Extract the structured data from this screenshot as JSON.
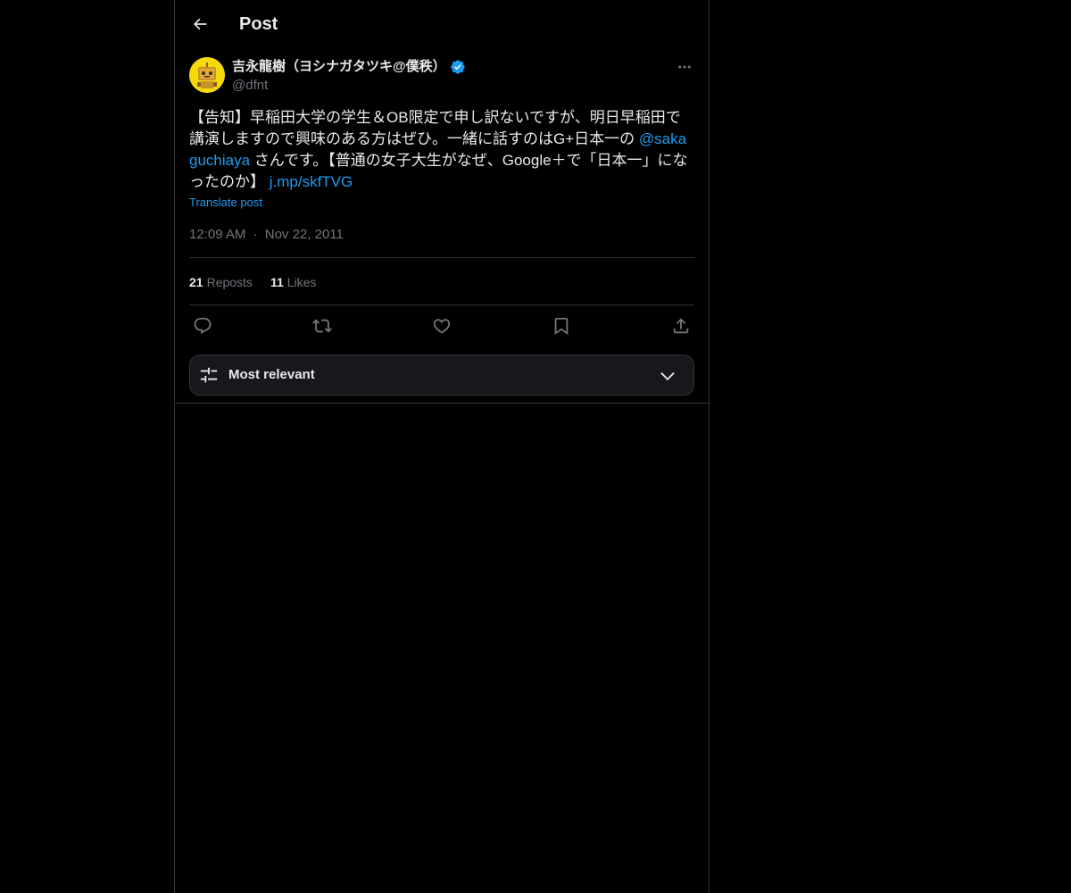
{
  "header": {
    "title": "Post"
  },
  "post": {
    "author_name": "吉永龍樹（ヨシナガタツキ@僕秩）",
    "author_handle": "@dfnt",
    "text_part1": "【告知】早稲田大学の学生＆OB限定で申し訳ないですが、明日早稲田で講演しますので興味のある方はぜひ。一緒に話すのはG+日本一の ",
    "mention": "@sakaguchiaya",
    "text_part2": " さんです。【普通の女子大生がなぜ、Google＋で「日本一」になったのか】 ",
    "link": "j.mp/skfTVG",
    "translate_label": "Translate post",
    "time": "12:09 AM",
    "separator": "·",
    "date": "Nov 22, 2011",
    "reposts_count": "21",
    "reposts_label": "Reposts",
    "likes_count": "11",
    "likes_label": "Likes"
  },
  "sort": {
    "label": "Most relevant"
  },
  "icons": {
    "back": "back-arrow-icon",
    "verified": "verified-badge-icon",
    "more": "more-icon",
    "reply": "reply-icon",
    "repost": "repost-icon",
    "like": "like-icon",
    "bookmark": "bookmark-icon",
    "share": "share-icon",
    "sort": "sliders-icon",
    "chevron": "chevron-down-icon"
  },
  "colors": {
    "background": "#000000",
    "text": "#e7e9ea",
    "secondary": "#71767b",
    "accent": "#1d9bf0",
    "border": "#2f3336"
  }
}
